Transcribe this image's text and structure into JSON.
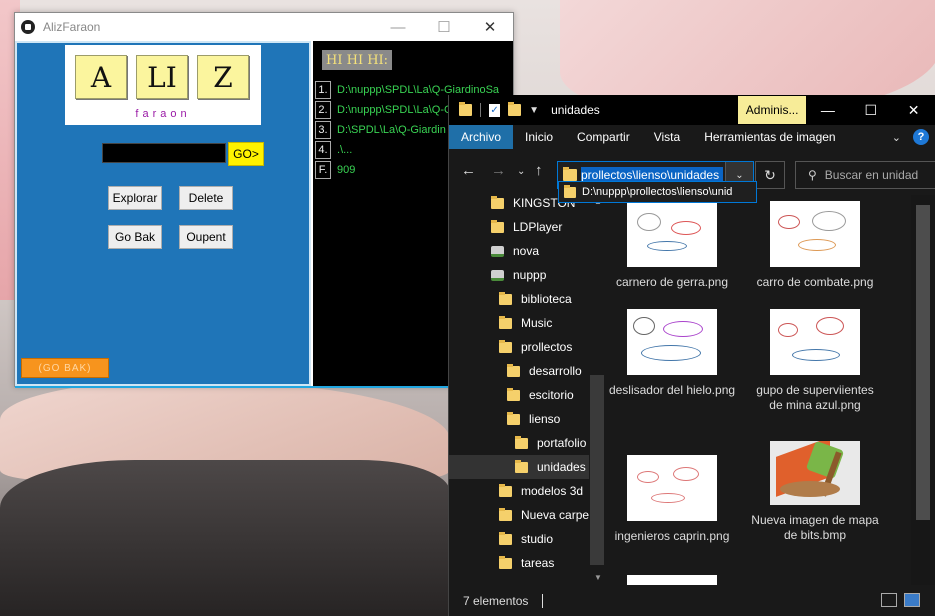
{
  "aliz": {
    "title": "AlizFaraon",
    "logo_letters": [
      "A",
      "LI",
      "Z"
    ],
    "logo_subtitle": "faraon",
    "go_label": "GO>",
    "explore_label": "Explorar",
    "delete_label": "Delete",
    "goback_label": "Go Bak",
    "open_label": "Oupent",
    "goback_orange_label": "(GO BAK)",
    "header_label": "HI HI HI:",
    "history": [
      {
        "num": "1.",
        "value": "D:\\nuppp\\SPDL\\La\\Q-GiardinoSa"
      },
      {
        "num": "2.",
        "value": "D:\\nuppp\\SPDL\\La\\Q-Giard"
      },
      {
        "num": "3.",
        "value": "D:\\SPDL\\La\\Q-Giardin"
      },
      {
        "num": "4.",
        "value": ".\\..."
      },
      {
        "num": "F.",
        "value": "909"
      }
    ]
  },
  "explorer": {
    "title": "unidades",
    "admin_tab": "Adminis...",
    "ribbon_tabs": [
      "Archivo",
      "Inicio",
      "Compartir",
      "Vista",
      "Herramientas de imagen"
    ],
    "address": "prollectos\\lienso\\unidades",
    "address_suggestion": "D:\\nuppp\\prollectos\\lienso\\unid",
    "search_placeholder": "Buscar en unidad",
    "nav_items": [
      "KINGSTON",
      "LDPlayer",
      "nova",
      "nuppp",
      "biblioteca",
      "Music",
      "prollectos",
      "desarrollo",
      "escitorio",
      "lienso",
      "portafolio",
      "unidades",
      "modelos 3d",
      "Nueva carpe",
      "studio",
      "tareas"
    ],
    "files": [
      "carnero de gerra.png",
      "carro de combate.png",
      "deslisador del hielo.png",
      "gupo de superviientes de mina azul.png",
      "ingenieros caprin.png",
      "Nueva imagen de mapa de bits.bmp"
    ],
    "status_count": "7 elementos"
  },
  "colors": {
    "aliz_blue": "#1f75b8",
    "logo_yellow": "#fbf59e",
    "go_yellow": "#fff200",
    "orange": "#f7941d",
    "history_green": "#39d353",
    "explorer_accent": "#0078d7",
    "admin_yellow": "#f7ec98"
  },
  "icons": {
    "folder": "folder-icon",
    "back": "back-arrow-icon",
    "forward": "forward-arrow-icon",
    "up": "up-arrow-icon",
    "refresh": "refresh-icon",
    "search": "search-icon",
    "help": "help-icon"
  }
}
